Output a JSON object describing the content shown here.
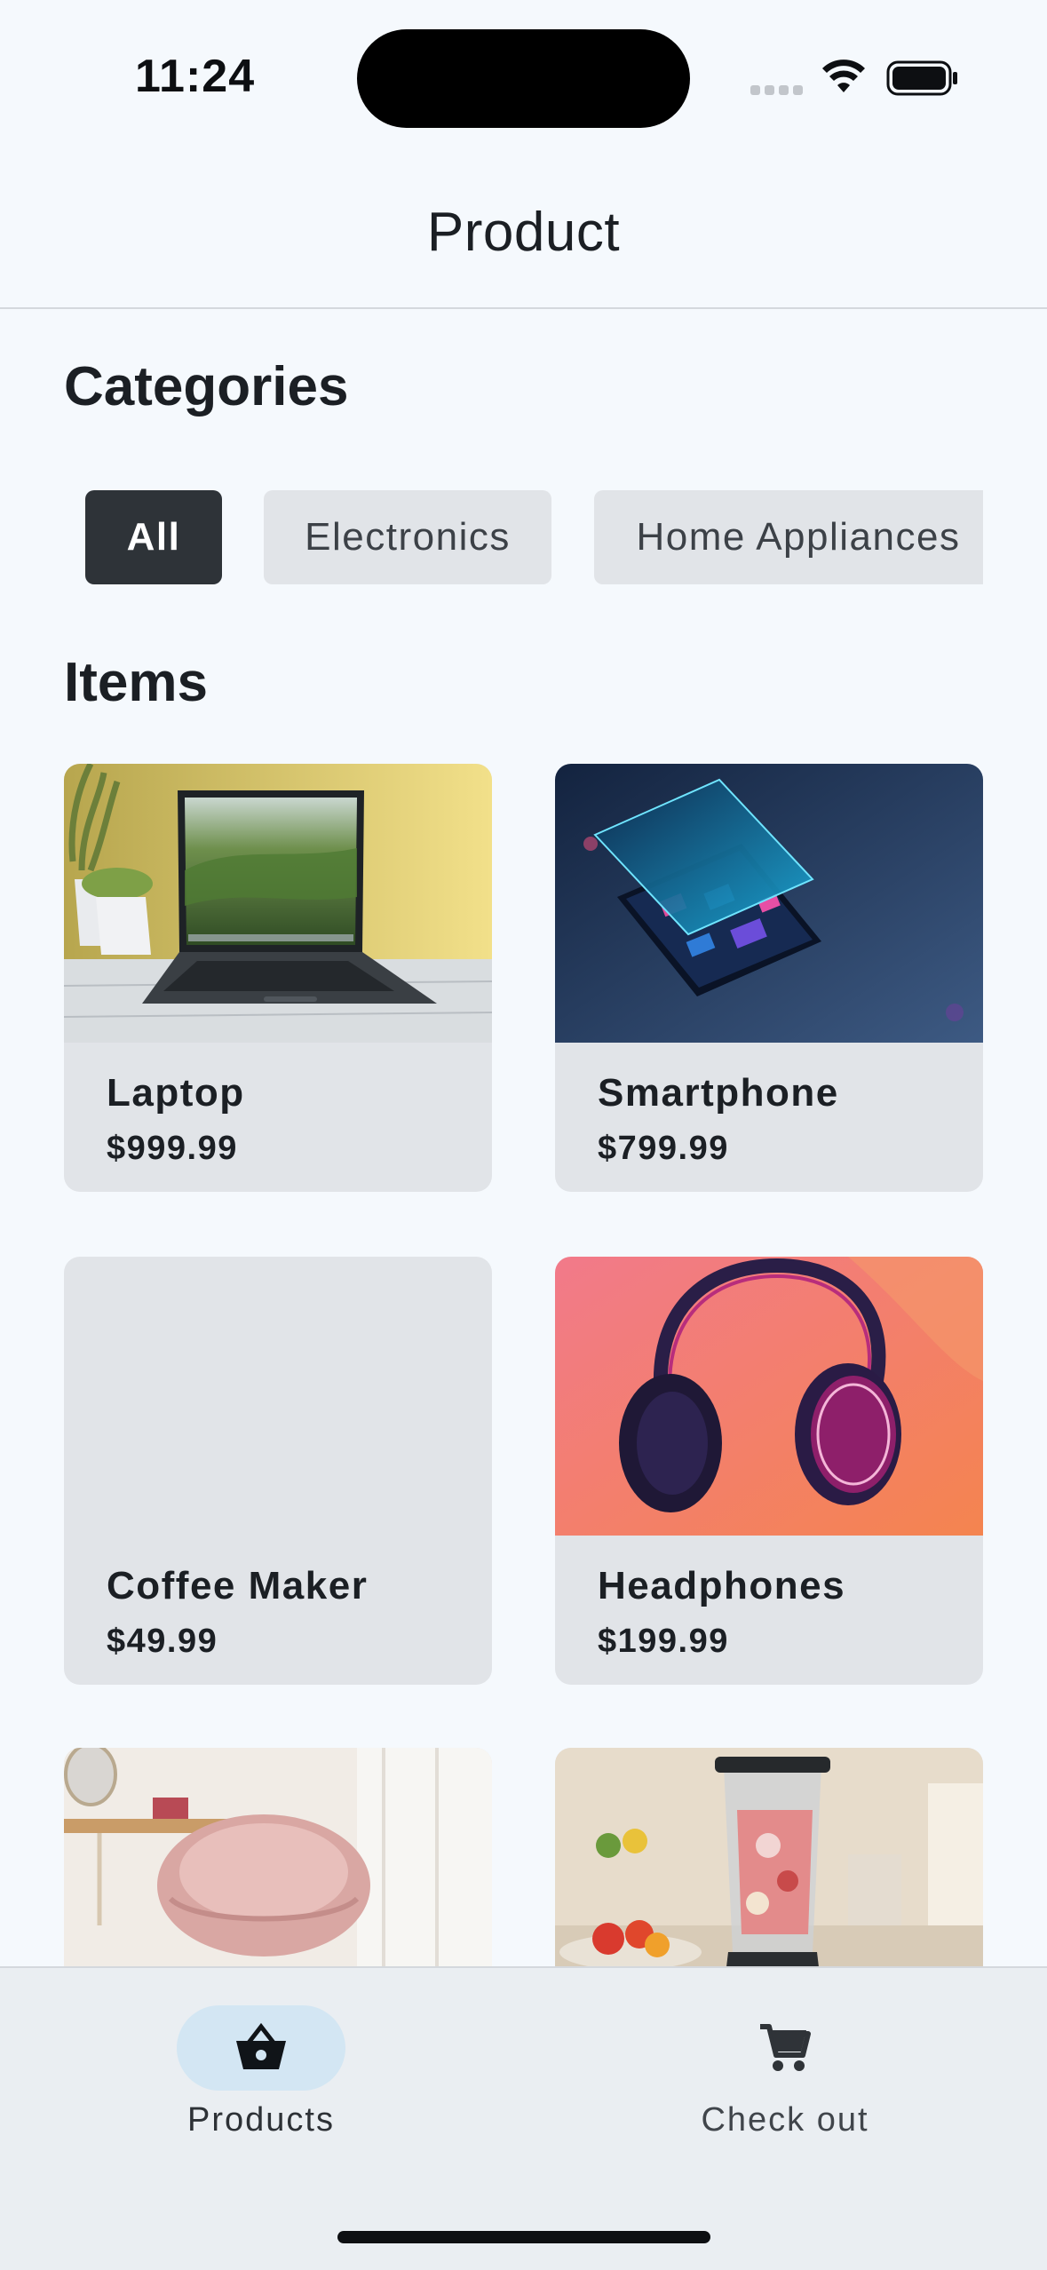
{
  "status_bar": {
    "time": "11:24"
  },
  "header": {
    "title": "Product"
  },
  "categories": {
    "title": "Categories",
    "chips": [
      {
        "label": "All",
        "selected": true
      },
      {
        "label": "Electronics",
        "selected": false
      },
      {
        "label": "Home Appliances",
        "selected": false
      }
    ]
  },
  "items": {
    "title": "Items",
    "products": [
      {
        "name": "Laptop",
        "price": "$999.99"
      },
      {
        "name": "Smartphone",
        "price": "$799.99"
      },
      {
        "name": "Coffee Maker",
        "price": "$49.99"
      },
      {
        "name": "Headphones",
        "price": "$199.99"
      },
      {
        "name": "",
        "price": ""
      },
      {
        "name": "",
        "price": ""
      }
    ]
  },
  "bottom_nav": {
    "items": [
      {
        "label": "Products",
        "icon": "basket-icon",
        "active": true
      },
      {
        "label": "Check out",
        "icon": "cart-icon",
        "active": false
      }
    ]
  },
  "colors": {
    "background": "#f5f9fd",
    "chip_active": "#2e3338",
    "chip_inactive": "#e1e4e8",
    "card": "#e1e4e8",
    "nav_active_pill": "#d3e6f3"
  }
}
